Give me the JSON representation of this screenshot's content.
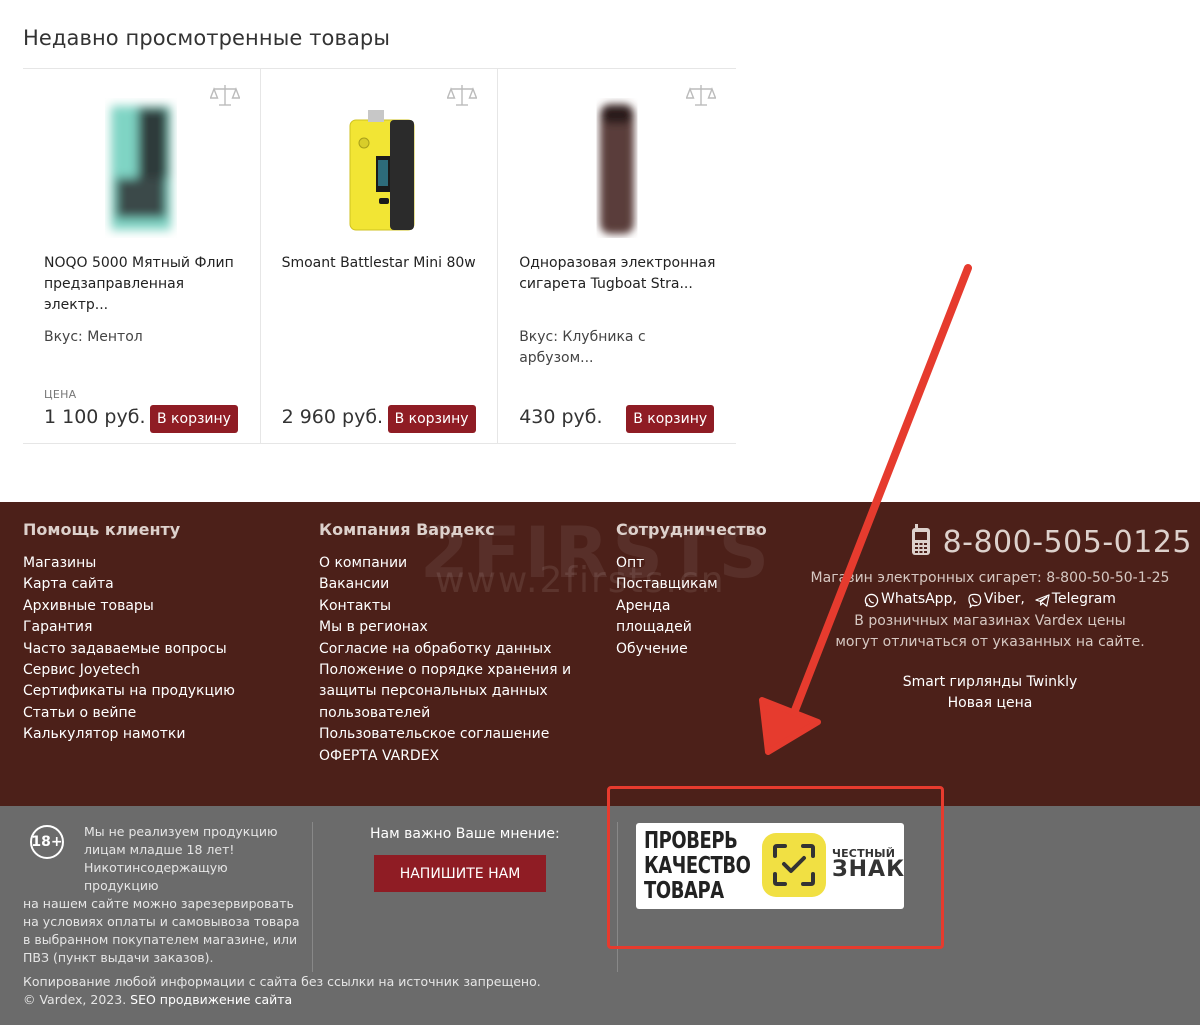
{
  "recent": {
    "title": "Недавно просмотренные товары",
    "products": [
      {
        "name": "NOQO 5000 Мятный Флип предзаправленная электр...",
        "attr": "Вкус: Ментол",
        "price_label": "ЦЕНА",
        "price": "1 100 руб.",
        "cart_label": "В корзину",
        "image_color": "#7fd4c4"
      },
      {
        "name": "Smoant Battlestar Mini 80w",
        "attr": "",
        "price_label": "",
        "price": "2 960 руб.",
        "cart_label": "В корзину",
        "image_color": "#f2e534"
      },
      {
        "name": "Одноразовая электронная сигарета Tugboat Stra...",
        "attr": "Вкус: Клубника с арбузом...",
        "price_label": "",
        "price": "430 руб.",
        "cart_label": "В корзину",
        "image_color": "#5a3e3a"
      }
    ]
  },
  "footer": {
    "col1": {
      "title": "Помощь клиенту",
      "links": [
        "Магазины",
        "Карта сайта",
        "Архивные товары",
        "Гарантия",
        "Часто задаваемые вопросы",
        "Сервис Joyetech",
        "Сертификаты на продукцию",
        "Статьи о вейпе",
        "Калькулятор намотки"
      ]
    },
    "col2": {
      "title": "Компания Вардекс",
      "links": [
        "О компании",
        "Вакансии",
        "Контакты",
        "Мы в регионах",
        "Согласие на обработку данных",
        "Положение о порядке хранения и",
        "защиты персональных данных",
        "пользователей",
        "Пользовательское соглашение",
        "ОФЕРТА VARDEX"
      ]
    },
    "col3": {
      "title": "Сотрудничество",
      "links": [
        "Опт",
        "Поставщикам",
        "Аренда",
        "площадей",
        "Обучение"
      ]
    },
    "phone": "8-800-505-0125",
    "shop_line": "Магазин электронных сигарет: 8-800-50-50-1-25",
    "messengers": [
      "WhatsApp,",
      "Viber,",
      "Telegram"
    ],
    "retail_note_1": "В розничных магазинах Vardex цены",
    "retail_note_2": "могут отличаться от указанных на сайте.",
    "promo_1": "Smart гирлянды Twinkly",
    "promo_2": "Новая цена",
    "watermark_1": "2FIRSTS",
    "watermark_2": "www.2firsts.cn"
  },
  "bottom": {
    "age": "18+",
    "disclaimer_1": "Мы не реализуем продукцию",
    "disclaimer_2": "лицам младше 18 лет!",
    "disclaimer_3": "Никотинсодержащую продукцию",
    "disclaimer_4": "на нашем сайте можно зарезервировать",
    "disclaimer_5": "на условиях оплаты и самовывоза товара",
    "disclaimer_6": "в выбранном покупателем магазине, или",
    "disclaimer_7": "ПВЗ (пункт выдачи заказов).",
    "feedback_label": "Нам важно Ваше мнение:",
    "write_button": "НАПИШИТЕ НАМ",
    "cz_line1": "ПРОВЕРЬ",
    "cz_line2": "КАЧЕСТВО",
    "cz_line3": "ТОВАРА",
    "cz_brand_small": "ЧЕСТНЫЙ",
    "cz_brand_big": "ЗНАК",
    "copy_1": "Копирование любой информации с сайта без ссылки на источник запрещено.",
    "copy_2_prefix": "© Vardex, 2023.",
    "copy_2_link": "SEO продвижение сайта"
  },
  "colors": {
    "brand_red": "#8f1c24",
    "footer_dark": "#4c2019",
    "footer_grey": "#6b6b6b",
    "annotation_red": "#e63b2e"
  }
}
